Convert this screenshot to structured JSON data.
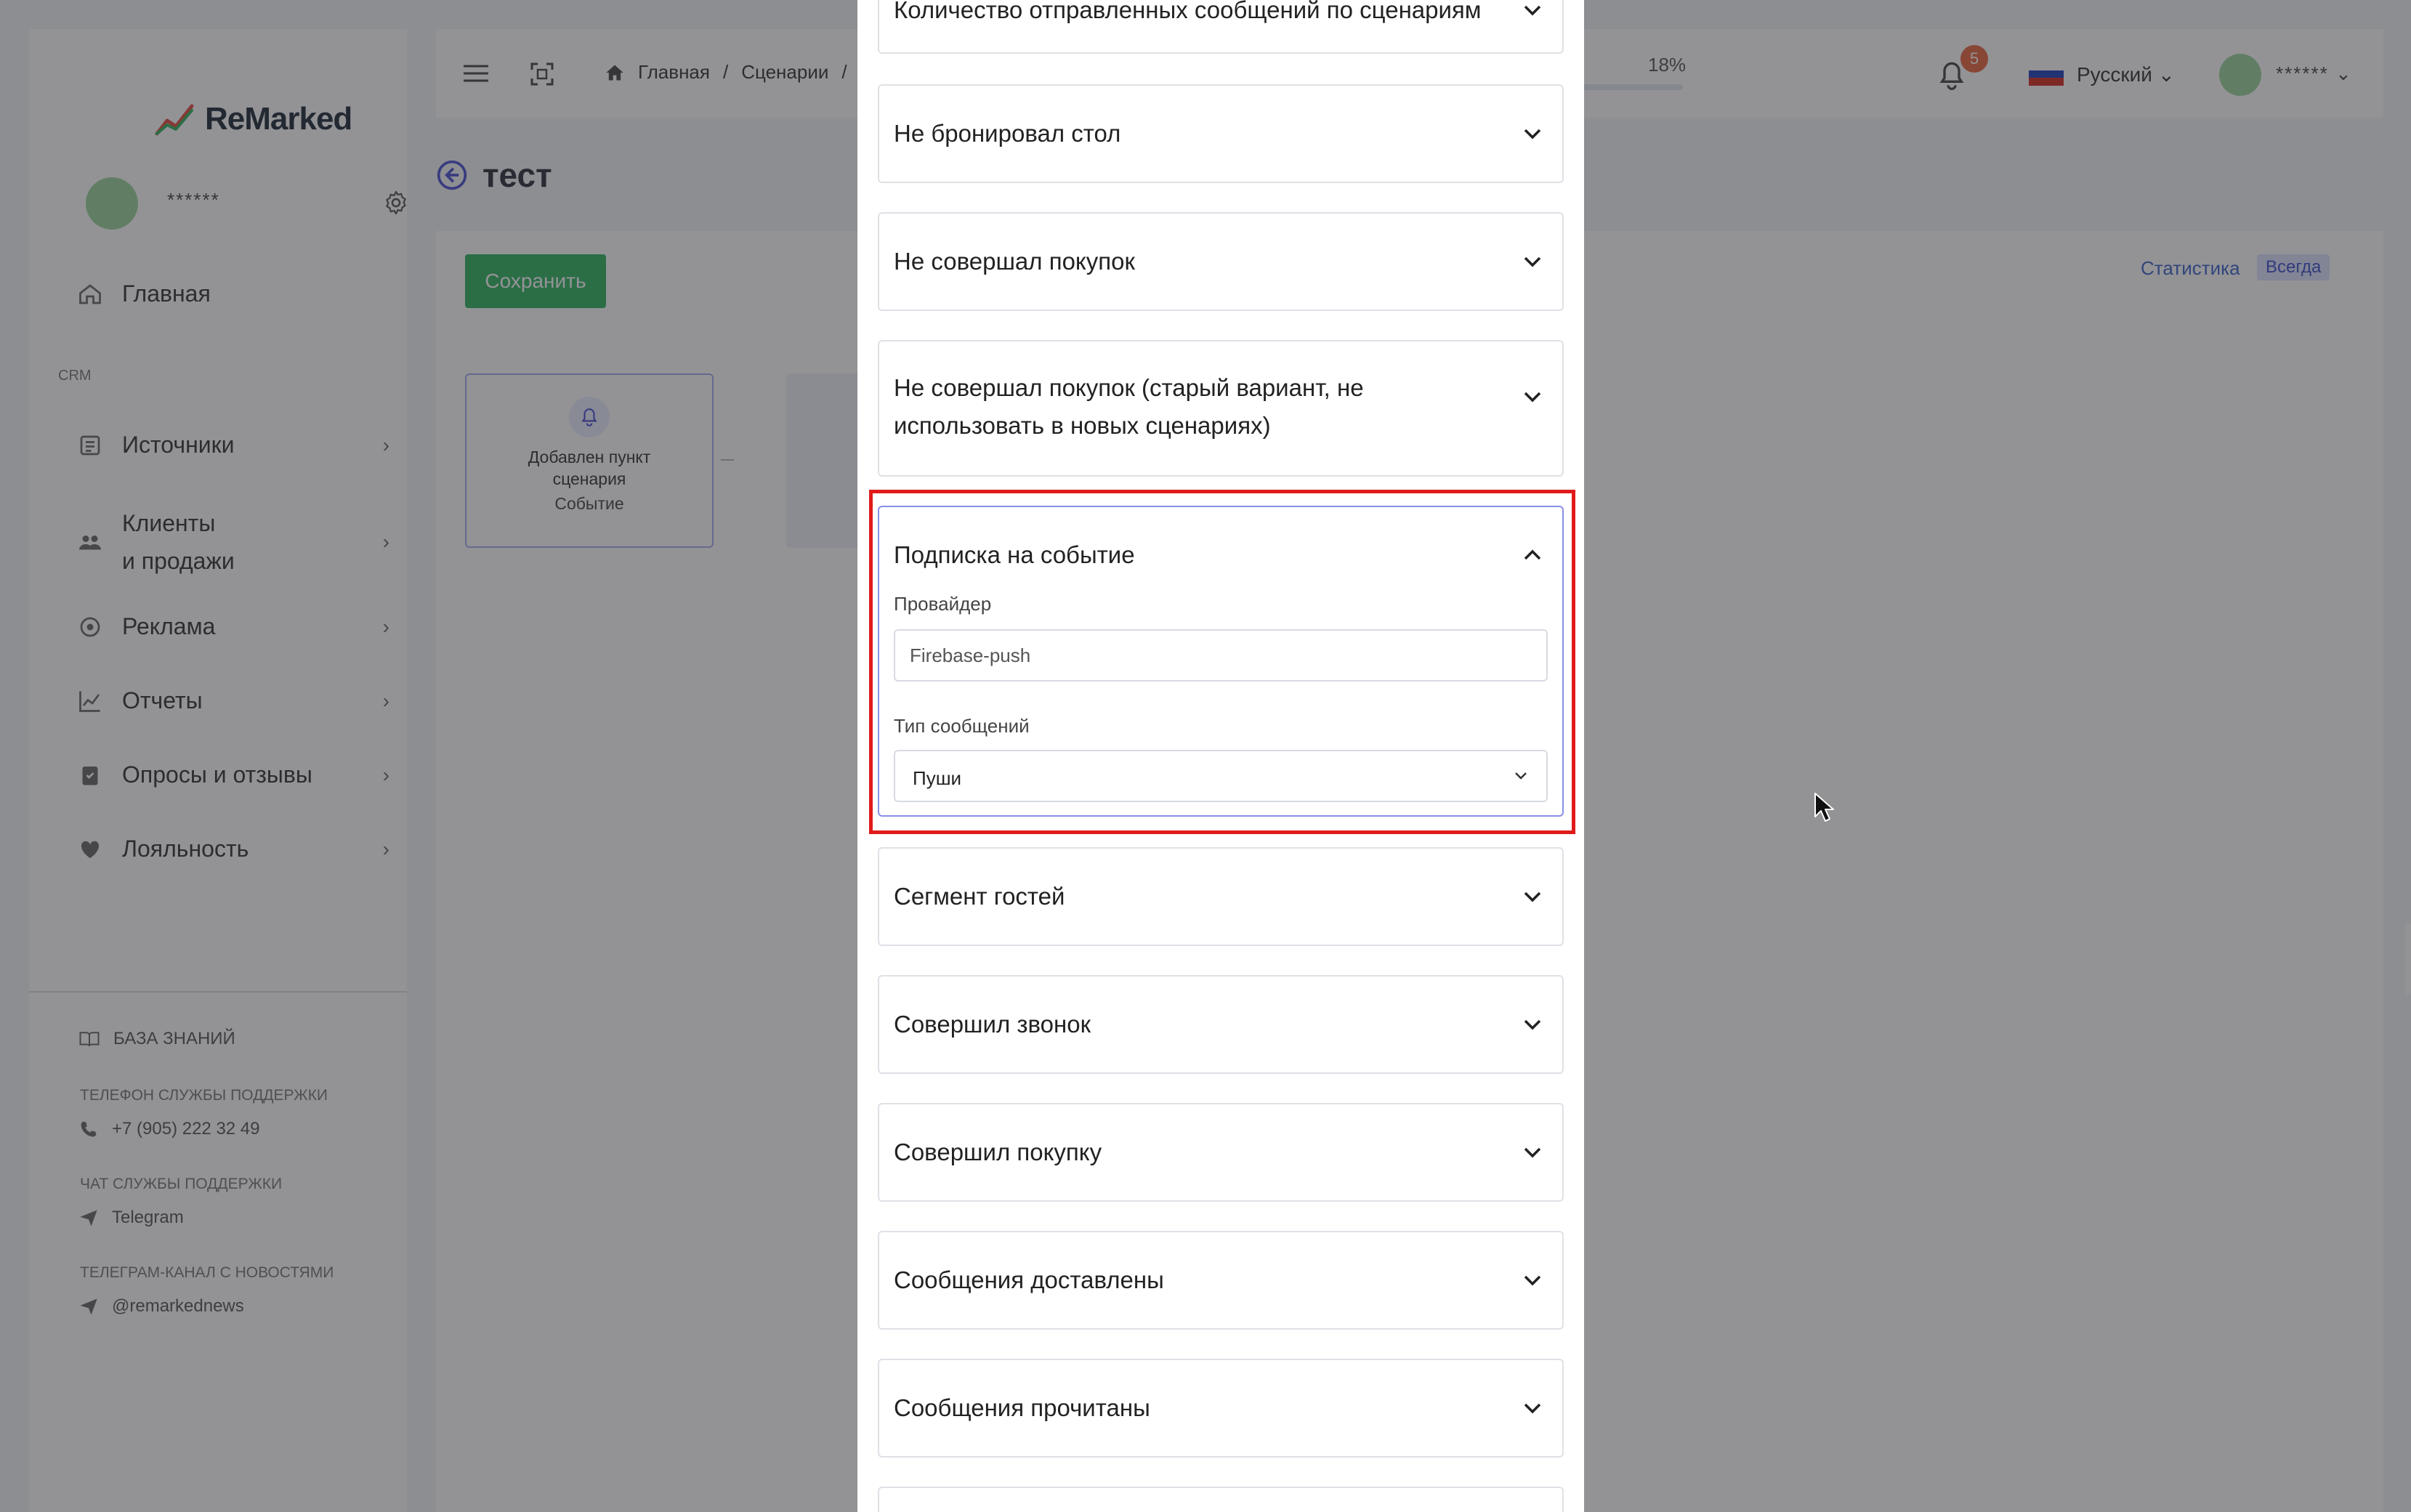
{
  "app": {
    "logo_text": "ReMarked",
    "user_name": "******",
    "nav_section_label": "CRM",
    "nav": [
      {
        "label": "Главная"
      },
      {
        "label": "Источники"
      },
      {
        "label": "Клиенты\nи продажи"
      },
      {
        "label": "Реклама"
      },
      {
        "label": "Отчеты"
      },
      {
        "label": "Опросы и отзывы"
      },
      {
        "label": "Лояльность"
      }
    ],
    "knowledge_base": "БАЗА ЗНАНИЙ",
    "support_phone_caption": "Телефон службы поддержки",
    "support_phone": "+7 (905) 222 32 49",
    "support_chat_caption": "Чат службы поддержки",
    "support_chat": "Telegram",
    "news_caption": "Телеграм-канал с новостями",
    "news_channel": "@remarkednews"
  },
  "topbar": {
    "breadcrumbs": [
      "Главная",
      "/",
      "Сценарии",
      "/"
    ],
    "progress_text": "18%",
    "notifications_count": "5",
    "language": "Русский",
    "user_name": "******"
  },
  "page": {
    "title": "тест",
    "save_label": "Сохранить",
    "stats_label": "Статистика",
    "period_badge": "Всегда",
    "node_title": "Добавлен пункт сценария",
    "node_sub": "Событие"
  },
  "modal": {
    "items": [
      {
        "title": "Количество отправленных сообщений по сценариям"
      },
      {
        "title": "Не бронировал стол"
      },
      {
        "title": "Не совершал покупок"
      },
      {
        "title": "Не совершал покупок (старый вариант, не использовать в новых сценариях)"
      },
      {
        "title": "Подписка на событие"
      },
      {
        "title": "Сегмент гостей"
      },
      {
        "title": "Совершил звонок"
      },
      {
        "title": "Совершил покупку"
      },
      {
        "title": "Сообщения доставлены"
      },
      {
        "title": "Сообщения прочитаны"
      }
    ],
    "open_item": {
      "provider_label": "Провайдер",
      "provider_value": "Firebase-push",
      "message_type_label": "Тип сообщений",
      "message_type_value": "Пуши"
    }
  },
  "colors": {
    "accent_green": "#2fb45e",
    "highlight_red": "#e01b1b",
    "open_border": "#8a8fe8",
    "badge_orange": "#e8643c"
  }
}
